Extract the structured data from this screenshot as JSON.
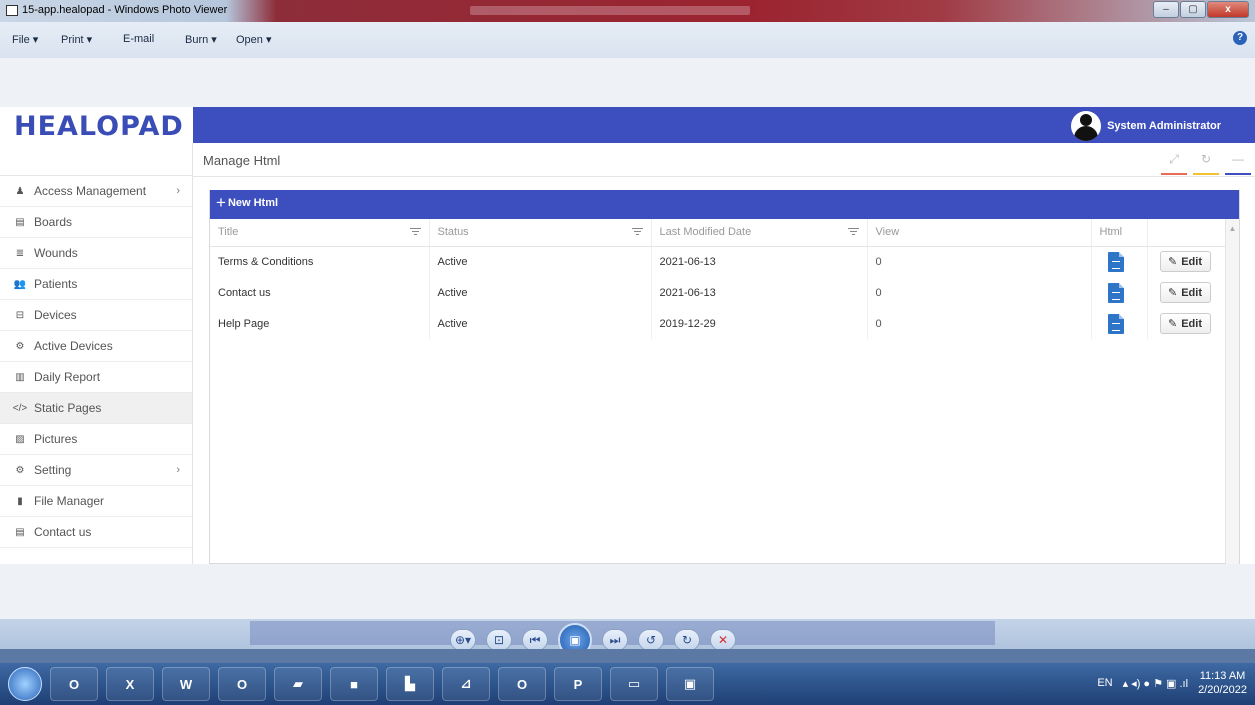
{
  "window": {
    "title": "15-app.healopad - Windows Photo Viewer",
    "controls": [
      "–",
      "▢",
      "x"
    ]
  },
  "menu": {
    "items": [
      "File ▾",
      "Print ▾",
      "E-mail",
      "Burn ▾",
      "Open ▾"
    ],
    "help_icon": "?"
  },
  "app": {
    "logo": "HEALOPAD",
    "user_name": "System Administrator",
    "brand_color": "#3d4fbf"
  },
  "sidebar": {
    "items": [
      {
        "label": "Access Management",
        "icon": "user-icon",
        "glyph": "♟",
        "has_children": true
      },
      {
        "label": "Boards",
        "icon": "board-icon",
        "glyph": "▤",
        "has_children": false
      },
      {
        "label": "Wounds",
        "icon": "database-icon",
        "glyph": "≣",
        "has_children": false
      },
      {
        "label": "Patients",
        "icon": "users-icon",
        "glyph": "👥",
        "has_children": false
      },
      {
        "label": "Devices",
        "icon": "hdd-icon",
        "glyph": "⊟",
        "has_children": false
      },
      {
        "label": "Active Devices",
        "icon": "gears-icon",
        "glyph": "⚙",
        "has_children": false
      },
      {
        "label": "Daily Report",
        "icon": "bar-chart-icon",
        "glyph": "▥",
        "has_children": false
      },
      {
        "label": "Static Pages",
        "icon": "code-icon",
        "glyph": "</>",
        "has_children": false,
        "active": true
      },
      {
        "label": "Pictures",
        "icon": "picture-icon",
        "glyph": "▨",
        "has_children": false
      },
      {
        "label": "Setting",
        "icon": "cogs-icon",
        "glyph": "⚙",
        "has_children": true
      },
      {
        "label": "File Manager",
        "icon": "file-icon",
        "glyph": "▮",
        "has_children": false
      },
      {
        "label": "Contact us",
        "icon": "file-text-icon",
        "glyph": "▤",
        "has_children": false
      }
    ],
    "chevron": "›"
  },
  "page": {
    "title": "Manage Html",
    "tools": [
      "⤢",
      "↻",
      "—"
    ]
  },
  "toolbar": {
    "new_label": "New Html",
    "plus": "+"
  },
  "table": {
    "columns": [
      "Title",
      "Status",
      "Last Modified Date",
      "View",
      "Html",
      ""
    ],
    "rows": [
      {
        "title": "Terms & Conditions",
        "status": "Active",
        "date": "2021-06-13",
        "view": "0"
      },
      {
        "title": "Contact us",
        "status": "Active",
        "date": "2021-06-13",
        "view": "0"
      },
      {
        "title": "Help Page",
        "status": "Active",
        "date": "2019-12-29",
        "view": "0"
      }
    ],
    "edit_label": "Edit",
    "edit_glyph": "✎"
  },
  "viewer": {
    "controls": [
      "⊕▾",
      "⊡",
      "⏮",
      "▣",
      "⏭",
      "↺",
      "↻",
      "✕"
    ]
  },
  "taskbar": {
    "apps": [
      "O",
      "X",
      "W",
      "O",
      "▰",
      "■",
      "▙",
      "⊿",
      "O",
      "P",
      "▭",
      "▣"
    ],
    "language": "EN",
    "time": "11:13 AM",
    "date": "2/20/2022"
  }
}
